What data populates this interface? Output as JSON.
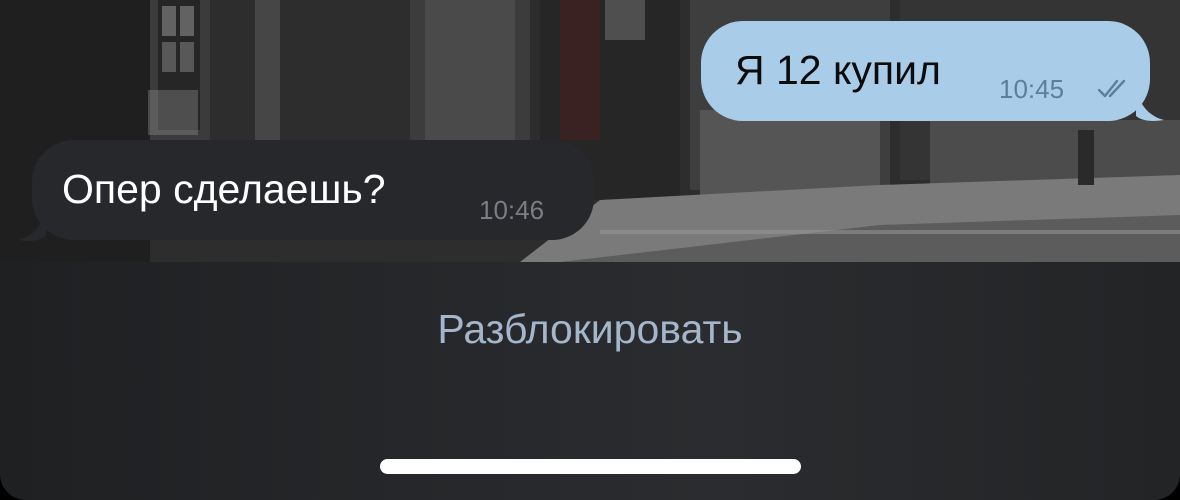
{
  "messages": [
    {
      "direction": "outgoing",
      "text": "Я 12 купил",
      "time": "10:45",
      "status": "read",
      "status_icon": "double-check-icon",
      "bubble_color": "#a9cde9"
    },
    {
      "direction": "incoming",
      "text": "Опер сделаешь?",
      "time": "10:46",
      "bubble_color": "#26282c"
    }
  ],
  "bottom_bar": {
    "unblock_label": "Разблокировать",
    "label_color": "#a4b6cb"
  }
}
